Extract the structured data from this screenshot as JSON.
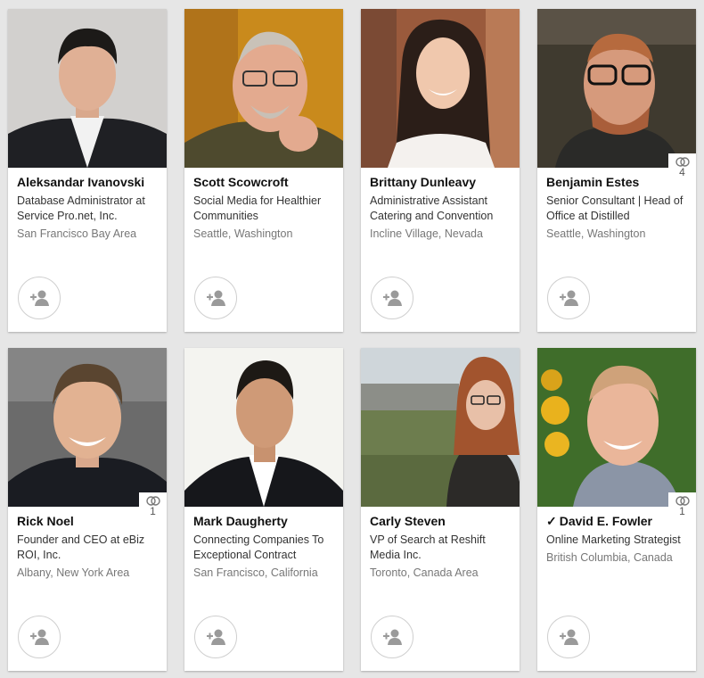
{
  "people": [
    {
      "name": "Aleksandar Ivanovski",
      "headline": "Database Administrator at Service Pro.net, Inc.",
      "location": "San Francisco Bay Area"
    },
    {
      "name": "Scott Scowcroft",
      "headline": "Social Media for Healthier Communities",
      "location": "Seattle, Washington"
    },
    {
      "name": "Brittany Dunleavy",
      "headline": "Administrative Assistant Catering and Convention",
      "location": "Incline Village, Nevada"
    },
    {
      "name": "Benjamin Estes",
      "headline": "Senior Consultant | Head of Office at Distilled",
      "location": "Seattle, Washington",
      "shared_count": "4"
    },
    {
      "name": "Rick Noel",
      "headline": "Founder and CEO at eBiz ROI, Inc.",
      "location": "Albany, New York Area",
      "shared_count": "1"
    },
    {
      "name": "Mark Daugherty",
      "headline": "Connecting Companies To Exceptional Contract",
      "location": "San Francisco, California"
    },
    {
      "name": "Carly Steven",
      "headline": "VP of Search at Reshift Media Inc.",
      "location": "Toronto, Canada Area"
    },
    {
      "name": "David E. Fowler",
      "name_prefix": "✓",
      "headline": "Online Marketing Strategist",
      "location": "British Columbia, Canada",
      "shared_count": "1"
    }
  ],
  "icons": {
    "connect": "add-connection-icon",
    "shared": "shared-connections-icon"
  },
  "colors": {
    "background": "#e6e6e6",
    "card": "#ffffff",
    "name_text": "#111111",
    "location_text": "#777777"
  }
}
